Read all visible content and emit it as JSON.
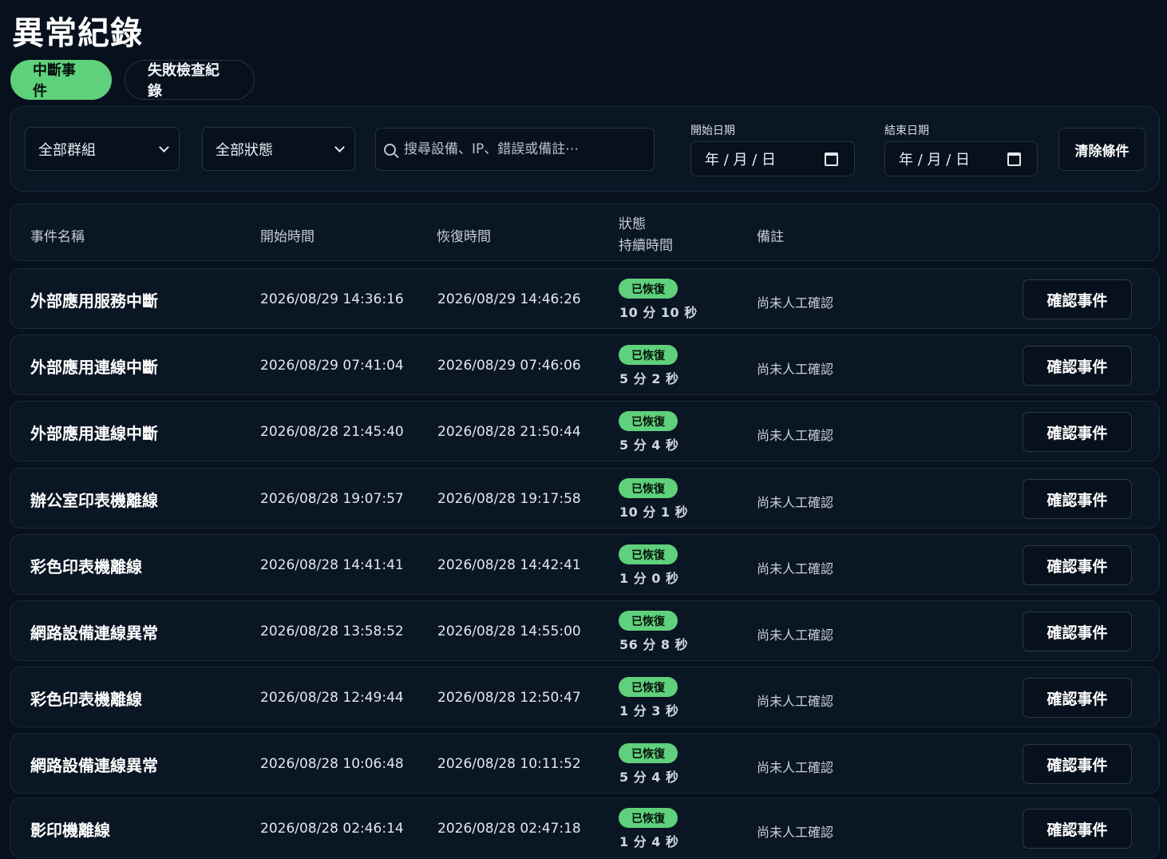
{
  "page_title": "異常紀錄",
  "tabs": [
    {
      "label": "中斷事件",
      "active": true
    },
    {
      "label": "失敗檢查紀錄",
      "active": false
    }
  ],
  "filters": {
    "group": {
      "value": "全部群組"
    },
    "status": {
      "value": "全部狀態"
    },
    "search": {
      "placeholder": "搜尋設備、IP、錯誤或備註⋯",
      "value": ""
    },
    "start_date": {
      "label": "開始日期",
      "value": "年 / 月 / 日"
    },
    "end_date": {
      "label": "結束日期",
      "value": "年 / 月 / 日"
    },
    "clear_label": "清除條件"
  },
  "table": {
    "headers": {
      "name": "事件名稱",
      "start": "開始時間",
      "recover": "恢復時間",
      "status": "狀態",
      "duration": "持續時間",
      "remark": "備註"
    },
    "rows": [
      {
        "name": "外部應用服務中斷",
        "start": "2026/08/29 14:36:16",
        "recover": "2026/08/29 14:46:26",
        "status": "已恢復",
        "duration": "10 分 10 秒",
        "remark": "尚未人工確認",
        "action": "確認事件"
      },
      {
        "name": "外部應用連線中斷",
        "start": "2026/08/29 07:41:04",
        "recover": "2026/08/29 07:46:06",
        "status": "已恢復",
        "duration": "5 分 2 秒",
        "remark": "尚未人工確認",
        "action": "確認事件"
      },
      {
        "name": "外部應用連線中斷",
        "start": "2026/08/28 21:45:40",
        "recover": "2026/08/28 21:50:44",
        "status": "已恢復",
        "duration": "5 分 4 秒",
        "remark": "尚未人工確認",
        "action": "確認事件"
      },
      {
        "name": "辦公室印表機離線",
        "start": "2026/08/28 19:07:57",
        "recover": "2026/08/28 19:17:58",
        "status": "已恢復",
        "duration": "10 分 1 秒",
        "remark": "尚未人工確認",
        "action": "確認事件"
      },
      {
        "name": "彩色印表機離線",
        "start": "2026/08/28 14:41:41",
        "recover": "2026/08/28 14:42:41",
        "status": "已恢復",
        "duration": "1 分 0 秒",
        "remark": "尚未人工確認",
        "action": "確認事件"
      },
      {
        "name": "網路設備連線異常",
        "start": "2026/08/28 13:58:52",
        "recover": "2026/08/28 14:55:00",
        "status": "已恢復",
        "duration": "56 分 8 秒",
        "remark": "尚未人工確認",
        "action": "確認事件"
      },
      {
        "name": "彩色印表機離線",
        "start": "2026/08/28 12:49:44",
        "recover": "2026/08/28 12:50:47",
        "status": "已恢復",
        "duration": "1 分 3 秒",
        "remark": "尚未人工確認",
        "action": "確認事件"
      },
      {
        "name": "網路設備連線異常",
        "start": "2026/08/28 10:06:48",
        "recover": "2026/08/28 10:11:52",
        "status": "已恢復",
        "duration": "5 分 4 秒",
        "remark": "尚未人工確認",
        "action": "確認事件"
      },
      {
        "name": "影印機離線",
        "start": "2026/08/28 02:46:14",
        "recover": "2026/08/28 02:47:18",
        "status": "已恢復",
        "duration": "1 分 4 秒",
        "remark": "尚未人工確認",
        "action": "確認事件"
      }
    ]
  },
  "colors": {
    "background": "#07111d",
    "panel": "#0b1624",
    "accent": "#5fd07b"
  },
  "icons": {
    "select": "chevron-down-icon",
    "search": "search-icon",
    "date": "calendar-icon"
  }
}
